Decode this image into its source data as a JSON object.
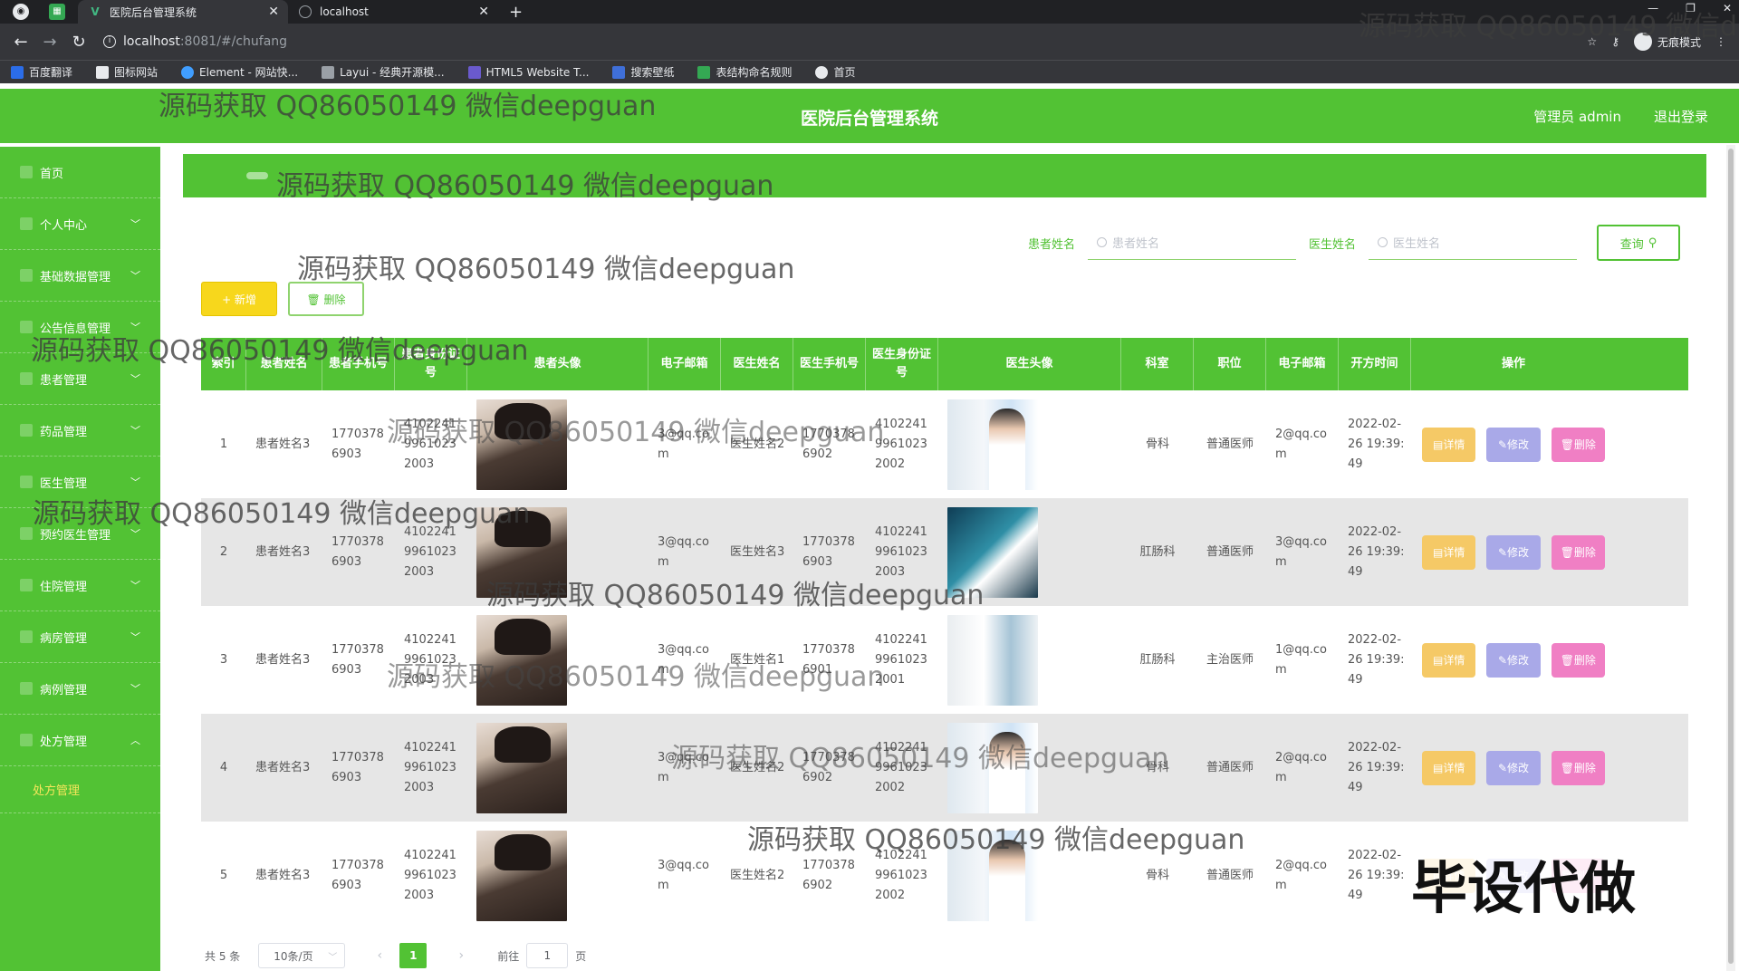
{
  "browser": {
    "tabs": [
      {
        "title": "医院后台管理系统",
        "active": true
      },
      {
        "title": "localhost",
        "active": false
      }
    ],
    "url_host": "localhost",
    "url_path": ":8081/#/chufang",
    "profile_label": "无痕模式",
    "bookmarks": [
      "百度翻译",
      "图标网站",
      "Element - 网站快...",
      "Layui - 经典开源模...",
      "HTML5 Website T...",
      "搜索壁纸",
      "表结构命名规则",
      "首页"
    ]
  },
  "header": {
    "title": "医院后台管理系统",
    "user": "管理员 admin",
    "logout": "退出登录"
  },
  "sidebar": {
    "items": [
      {
        "label": "首页",
        "chevron": ""
      },
      {
        "label": "个人中心",
        "chevron": "﹀"
      },
      {
        "label": "基础数据管理",
        "chevron": "﹀"
      },
      {
        "label": "公告信息管理",
        "chevron": "﹀"
      },
      {
        "label": "患者管理",
        "chevron": "﹀"
      },
      {
        "label": "药品管理",
        "chevron": "﹀"
      },
      {
        "label": "医生管理",
        "chevron": "﹀"
      },
      {
        "label": "预约医生管理",
        "chevron": "﹀"
      },
      {
        "label": "住院管理",
        "chevron": "﹀"
      },
      {
        "label": "病房管理",
        "chevron": "﹀"
      },
      {
        "label": "病例管理",
        "chevron": "﹀"
      },
      {
        "label": "处方管理",
        "chevron": "︿"
      }
    ],
    "sub_item": "处方管理"
  },
  "search": {
    "patient_label": "患者姓名",
    "patient_placeholder": "患者姓名",
    "doctor_label": "医生姓名",
    "doctor_placeholder": "医生姓名",
    "button": "查询"
  },
  "actions": {
    "add": "+ 新增",
    "delete": "🗑 删除"
  },
  "table": {
    "columns": [
      "索引",
      "患者姓名",
      "患者手机号",
      "患者身份证号",
      "患者头像",
      "电子邮箱",
      "医生姓名",
      "医生手机号",
      "医生身份证号",
      "医生头像",
      "科室",
      "职位",
      "电子邮箱",
      "开方时间",
      "操作"
    ],
    "rows": [
      {
        "index": "1",
        "patient_name": "患者姓名3",
        "patient_phone": "17703786903",
        "patient_id": "410224199610232003",
        "patient_email": "3@qq.com",
        "doctor_name": "医生姓名2",
        "doctor_phone": "17703786902",
        "doctor_id": "410224199610232002",
        "doctor_photo": "a",
        "dept": "骨科",
        "position": "普通医师",
        "doctor_email": "2@qq.com",
        "time": "2022-02-26 19:39:49"
      },
      {
        "index": "2",
        "patient_name": "患者姓名3",
        "patient_phone": "17703786903",
        "patient_id": "410224199610232003",
        "patient_email": "3@qq.com",
        "doctor_name": "医生姓名3",
        "doctor_phone": "17703786903",
        "doctor_id": "410224199610232003",
        "doctor_photo": "b",
        "dept": "肛肠科",
        "position": "普通医师",
        "doctor_email": "3@qq.com",
        "time": "2022-02-26 19:39:49"
      },
      {
        "index": "3",
        "patient_name": "患者姓名3",
        "patient_phone": "17703786903",
        "patient_id": "410224199610232003",
        "patient_email": "3@qq.com",
        "doctor_name": "医生姓名1",
        "doctor_phone": "17703786901",
        "doctor_id": "410224199610232001",
        "doctor_photo": "c",
        "dept": "肛肠科",
        "position": "主治医师",
        "doctor_email": "1@qq.com",
        "time": "2022-02-26 19:39:49"
      },
      {
        "index": "4",
        "patient_name": "患者姓名3",
        "patient_phone": "17703786903",
        "patient_id": "410224199610232003",
        "patient_email": "3@qq.com",
        "doctor_name": "医生姓名2",
        "doctor_phone": "17703786902",
        "doctor_id": "410224199610232002",
        "doctor_photo": "a",
        "dept": "骨科",
        "position": "普通医师",
        "doctor_email": "2@qq.com",
        "time": "2022-02-26 19:39:49"
      },
      {
        "index": "5",
        "patient_name": "患者姓名3",
        "patient_phone": "17703786903",
        "patient_id": "410224199610232003",
        "patient_email": "3@qq.com",
        "doctor_name": "医生姓名2",
        "doctor_phone": "17703786902",
        "doctor_id": "410224199610232002",
        "doctor_photo": "a",
        "dept": "骨科",
        "position": "普通医师",
        "doctor_email": "2@qq.com",
        "time": "2022-02-26 19:39:49"
      }
    ],
    "op_detail": "详情",
    "op_edit": "修改",
    "op_delete": "删除"
  },
  "pagination": {
    "total": "共 5 条",
    "page_size": "10条/页",
    "current_page": "1",
    "goto_prefix": "前往",
    "goto_value": "1",
    "goto_suffix": "页"
  },
  "watermark": {
    "text": "源码获取 QQ86050149 微信deepguan",
    "stamp": "毕设代做"
  },
  "colors": {
    "primary": "#52c234",
    "add_button": "#f7d71c",
    "detail_button": "#f5c966",
    "edit_button": "#a9a9e8",
    "delete_button": "#f07fc4"
  }
}
